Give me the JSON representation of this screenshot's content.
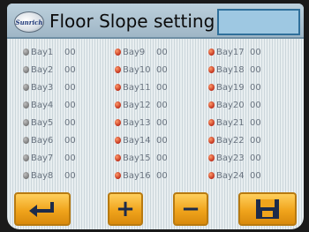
{
  "header": {
    "logo_text": "Sunrich",
    "title": "Floor Slope setting"
  },
  "bays": [
    {
      "label": "Bay1",
      "value": "00"
    },
    {
      "label": "Bay2",
      "value": "00"
    },
    {
      "label": "Bay3",
      "value": "00"
    },
    {
      "label": "Bay4",
      "value": "00"
    },
    {
      "label": "Bay5",
      "value": "00"
    },
    {
      "label": "Bay6",
      "value": "00"
    },
    {
      "label": "Bay7",
      "value": "00"
    },
    {
      "label": "Bay8",
      "value": "00"
    },
    {
      "label": "Bay9",
      "value": "00"
    },
    {
      "label": "Bay10",
      "value": "00"
    },
    {
      "label": "Bay11",
      "value": "00"
    },
    {
      "label": "Bay12",
      "value": "00"
    },
    {
      "label": "Bay13",
      "value": "00"
    },
    {
      "label": "Bay14",
      "value": "00"
    },
    {
      "label": "Bay15",
      "value": "00"
    },
    {
      "label": "Bay16",
      "value": "00"
    },
    {
      "label": "Bay17",
      "value": "00"
    },
    {
      "label": "Bay18",
      "value": "00"
    },
    {
      "label": "Bay19",
      "value": "00"
    },
    {
      "label": "Bay20",
      "value": "00"
    },
    {
      "label": "Bay21",
      "value": "00"
    },
    {
      "label": "Bay22",
      "value": "00"
    },
    {
      "label": "Bay23",
      "value": "00"
    },
    {
      "label": "Bay24",
      "value": "00"
    }
  ],
  "toolbar": {
    "back_icon": "back-arrow-icon",
    "plus_label": "+",
    "minus_label": "−",
    "save_icon": "save-disk-icon"
  },
  "colors": {
    "button": "#f0a41c",
    "header": "#9fb6c6",
    "indicator": "#c0321e"
  }
}
